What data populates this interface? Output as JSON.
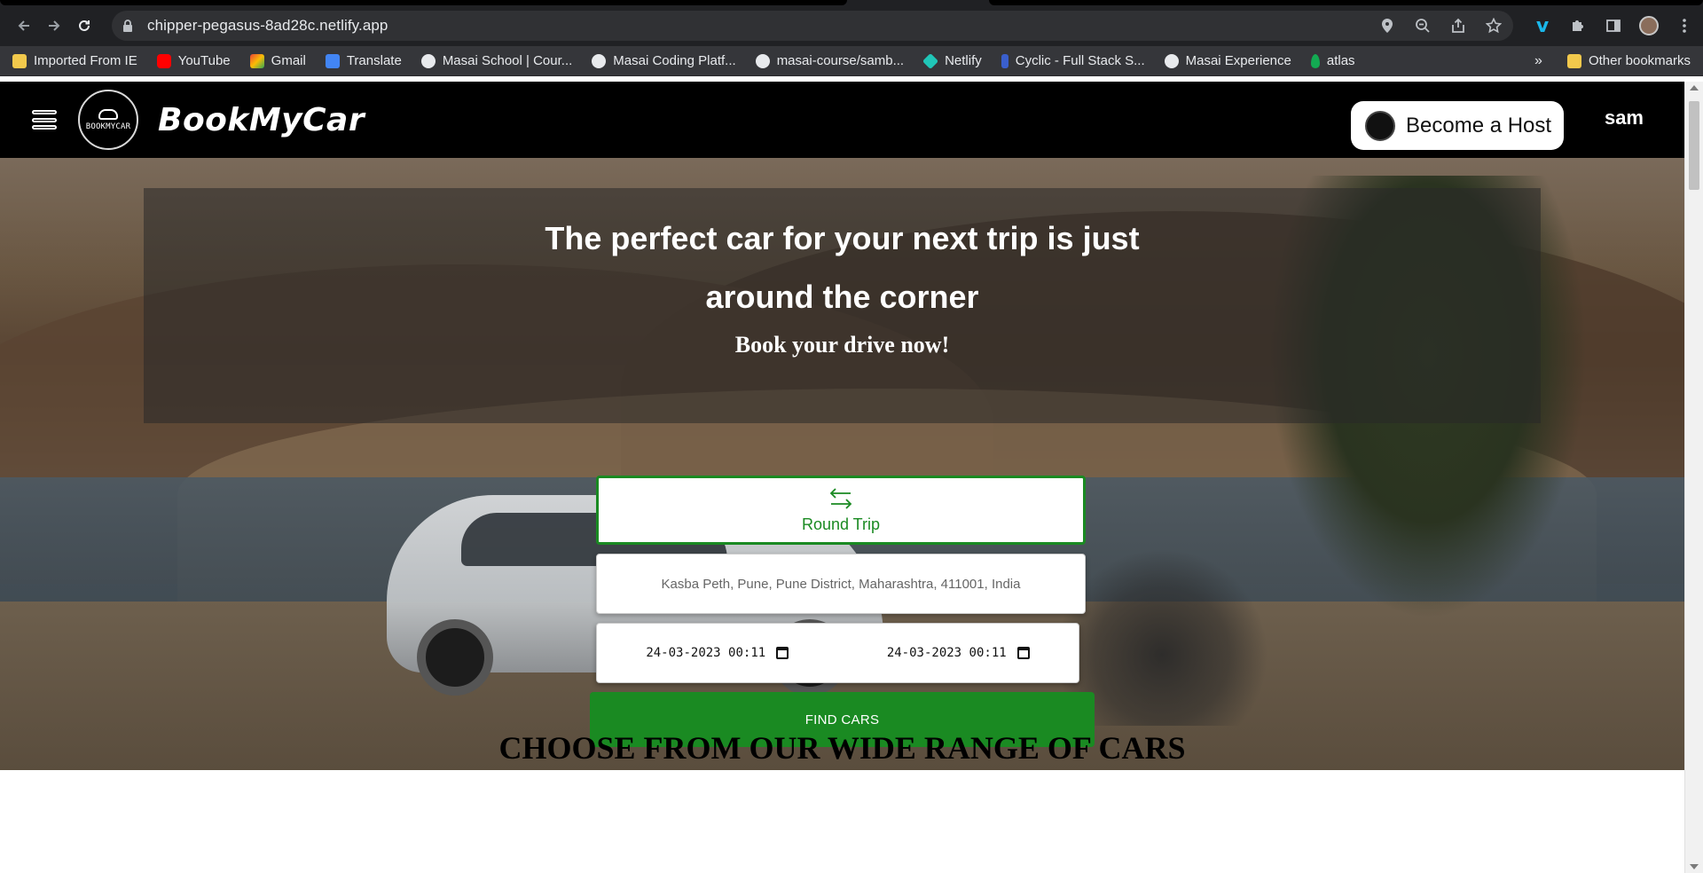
{
  "browser": {
    "url": "chipper-pegasus-8ad28c.netlify.app",
    "bookmarks": [
      {
        "label": "Imported From IE",
        "color": "#f2c94c"
      },
      {
        "label": "YouTube",
        "color": "#ff0000"
      },
      {
        "label": "Gmail",
        "color": "#ea4335"
      },
      {
        "label": "Translate",
        "color": "#4285f4"
      },
      {
        "label": "Masai School | Cour...",
        "color": "#e8eaed"
      },
      {
        "label": "Masai Coding Platf...",
        "color": "#e8eaed"
      },
      {
        "label": "masai-course/samb...",
        "color": "#e8eaed"
      },
      {
        "label": "Netlify",
        "color": "#20c6b7"
      },
      {
        "label": "Cyclic - Full Stack S...",
        "color": "#3a5fcd"
      },
      {
        "label": "Masai Experience",
        "color": "#e8eaed"
      },
      {
        "label": "atlas",
        "color": "#13aa52"
      }
    ],
    "more": "»",
    "other_bookmarks": "Other bookmarks"
  },
  "header": {
    "logo_text": "BOOKMYCAR",
    "brand": "BookMyCar",
    "host_button": "Become a Host",
    "user": "sam"
  },
  "hero": {
    "title_line1": "The perfect car for your next trip is just",
    "title_line2": "around the corner",
    "subtitle": "Book your drive now!",
    "trip_type": "Round Trip",
    "location": "Kasba Peth, Pune, Pune District, Maharashtra, 411001, India",
    "start_datetime": "24-03-2023 00:11",
    "end_datetime": "24-03-2023 00:11",
    "find_button": "FIND CARS"
  },
  "section": {
    "title": "CHOOSE FROM OUR WIDE RANGE OF CARS"
  },
  "colors": {
    "accent": "#1a8a22",
    "header_bg": "#000000"
  }
}
